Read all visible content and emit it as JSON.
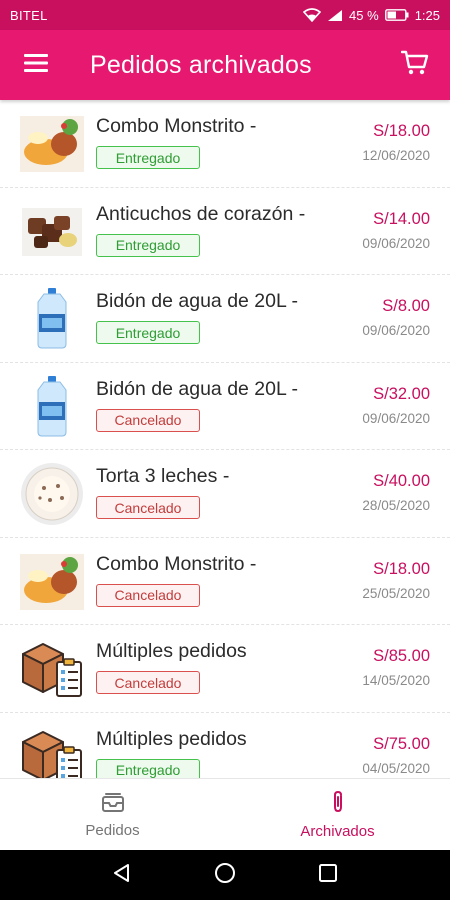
{
  "status_bar": {
    "carrier": "BITEL",
    "battery": "45 %",
    "time": "1:25"
  },
  "header": {
    "title": "Pedidos archivados",
    "menu_icon": "hamburger-icon",
    "cart_icon": "cart-icon"
  },
  "colors": {
    "primary": "#e6186f",
    "primary_dark": "#c8105f",
    "delivered": "#45c24b",
    "cancelled": "#d9504f"
  },
  "orders": [
    {
      "name": "Combo Monstrito -",
      "status": "Entregado",
      "price": "S/18.00",
      "date": "12/06/2020",
      "image": "combo-food-image"
    },
    {
      "name": "Anticuchos de corazón -",
      "status": "Entregado",
      "price": "S/14.00",
      "date": "09/06/2020",
      "image": "anticuchos-image"
    },
    {
      "name": "Bidón de agua de 20L -",
      "status": "Entregado",
      "price": "S/8.00",
      "date": "09/06/2020",
      "image": "water-jug-image"
    },
    {
      "name": "Bidón de agua de 20L -",
      "status": "Cancelado",
      "price": "S/32.00",
      "date": "09/06/2020",
      "image": "water-jug-image"
    },
    {
      "name": "Torta 3 leches -",
      "status": "Cancelado",
      "price": "S/40.00",
      "date": "28/05/2020",
      "image": "cake-image"
    },
    {
      "name": "Combo Monstrito -",
      "status": "Cancelado",
      "price": "S/18.00",
      "date": "25/05/2020",
      "image": "combo-food-image"
    },
    {
      "name": "Múltiples pedidos",
      "status": "Cancelado",
      "price": "S/85.00",
      "date": "14/05/2020",
      "image": "box-checklist-icon"
    },
    {
      "name": "Múltiples pedidos",
      "status": "Entregado",
      "price": "S/75.00",
      "date": "04/05/2020",
      "image": "box-checklist-icon"
    }
  ],
  "bottom_nav": {
    "tabs": [
      {
        "label": "Pedidos",
        "icon": "inbox-icon",
        "active": false
      },
      {
        "label": "Archivados",
        "icon": "paperclip-icon",
        "active": true
      }
    ]
  },
  "system_nav": {
    "back_icon": "back-triangle-icon",
    "home_icon": "home-circle-icon",
    "recents_icon": "recents-square-icon"
  }
}
